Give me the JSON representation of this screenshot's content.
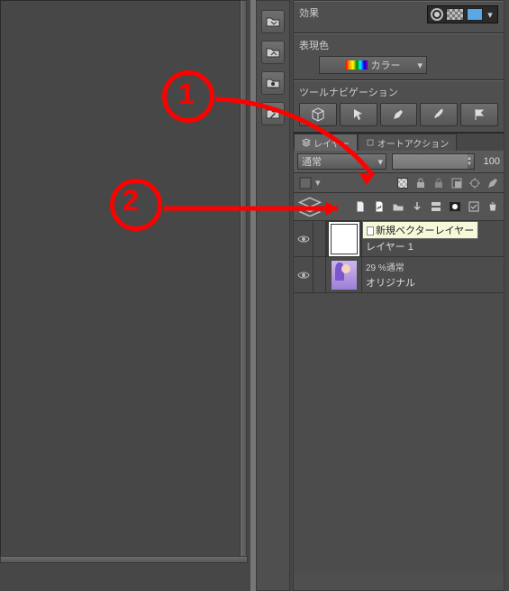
{
  "effects": {
    "title": "効果"
  },
  "display_color": {
    "title": "表現色",
    "selected": "カラー"
  },
  "tool_nav": {
    "title": "ツールナビゲーション"
  },
  "tabs": {
    "layer": "レイヤー",
    "autoaction": "オートアクション"
  },
  "layer_panel": {
    "blend_mode": "通常",
    "opacity": "100"
  },
  "layers": [
    {
      "tooltip": "新規ベクターレイヤー",
      "name": "レイヤー 1"
    },
    {
      "blend_info": "29 %通常",
      "name": "オリジナル"
    }
  ],
  "annotations": {
    "one": "1",
    "two": "2"
  }
}
